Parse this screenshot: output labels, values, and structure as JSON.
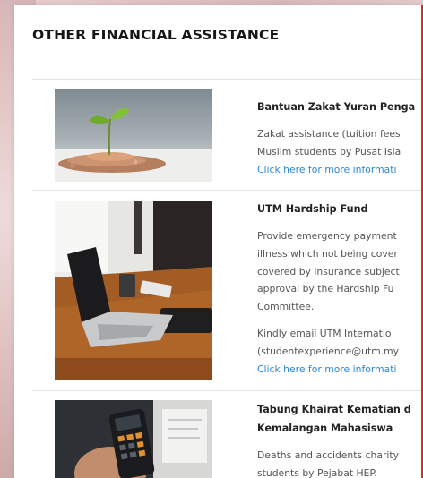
{
  "page_title": "OTHER FINANCIAL ASSISTANCE",
  "items": [
    {
      "title": "Bantuan Zakat Yuran Penga",
      "description_lines": [
        "Zakat assistance (tuition fees",
        "Muslim students by Pusat Isla"
      ],
      "link": "Click here for more informati",
      "image": "plant-growing-from-coins"
    },
    {
      "title": "UTM Hardship Fund",
      "description_lines": [
        "Provide emergency payment",
        "illness which not being cover",
        "covered by insurance subject",
        "approval by the Hardship Fu",
        "Committee."
      ],
      "contact_lines": [
        "Kindly email UTM Internatio",
        "(studentexperience@utm.my"
      ],
      "link": "Click here for more informati",
      "image": "laptop-on-wooden-desk"
    },
    {
      "title": "Tabung Khairat Kematian d",
      "title_line2": "Kemalangan Mahasiswa",
      "description_lines": [
        "Deaths and accidents charity",
        "students by Pejabat HEP."
      ],
      "image": "hand-holding-calculator"
    }
  ]
}
